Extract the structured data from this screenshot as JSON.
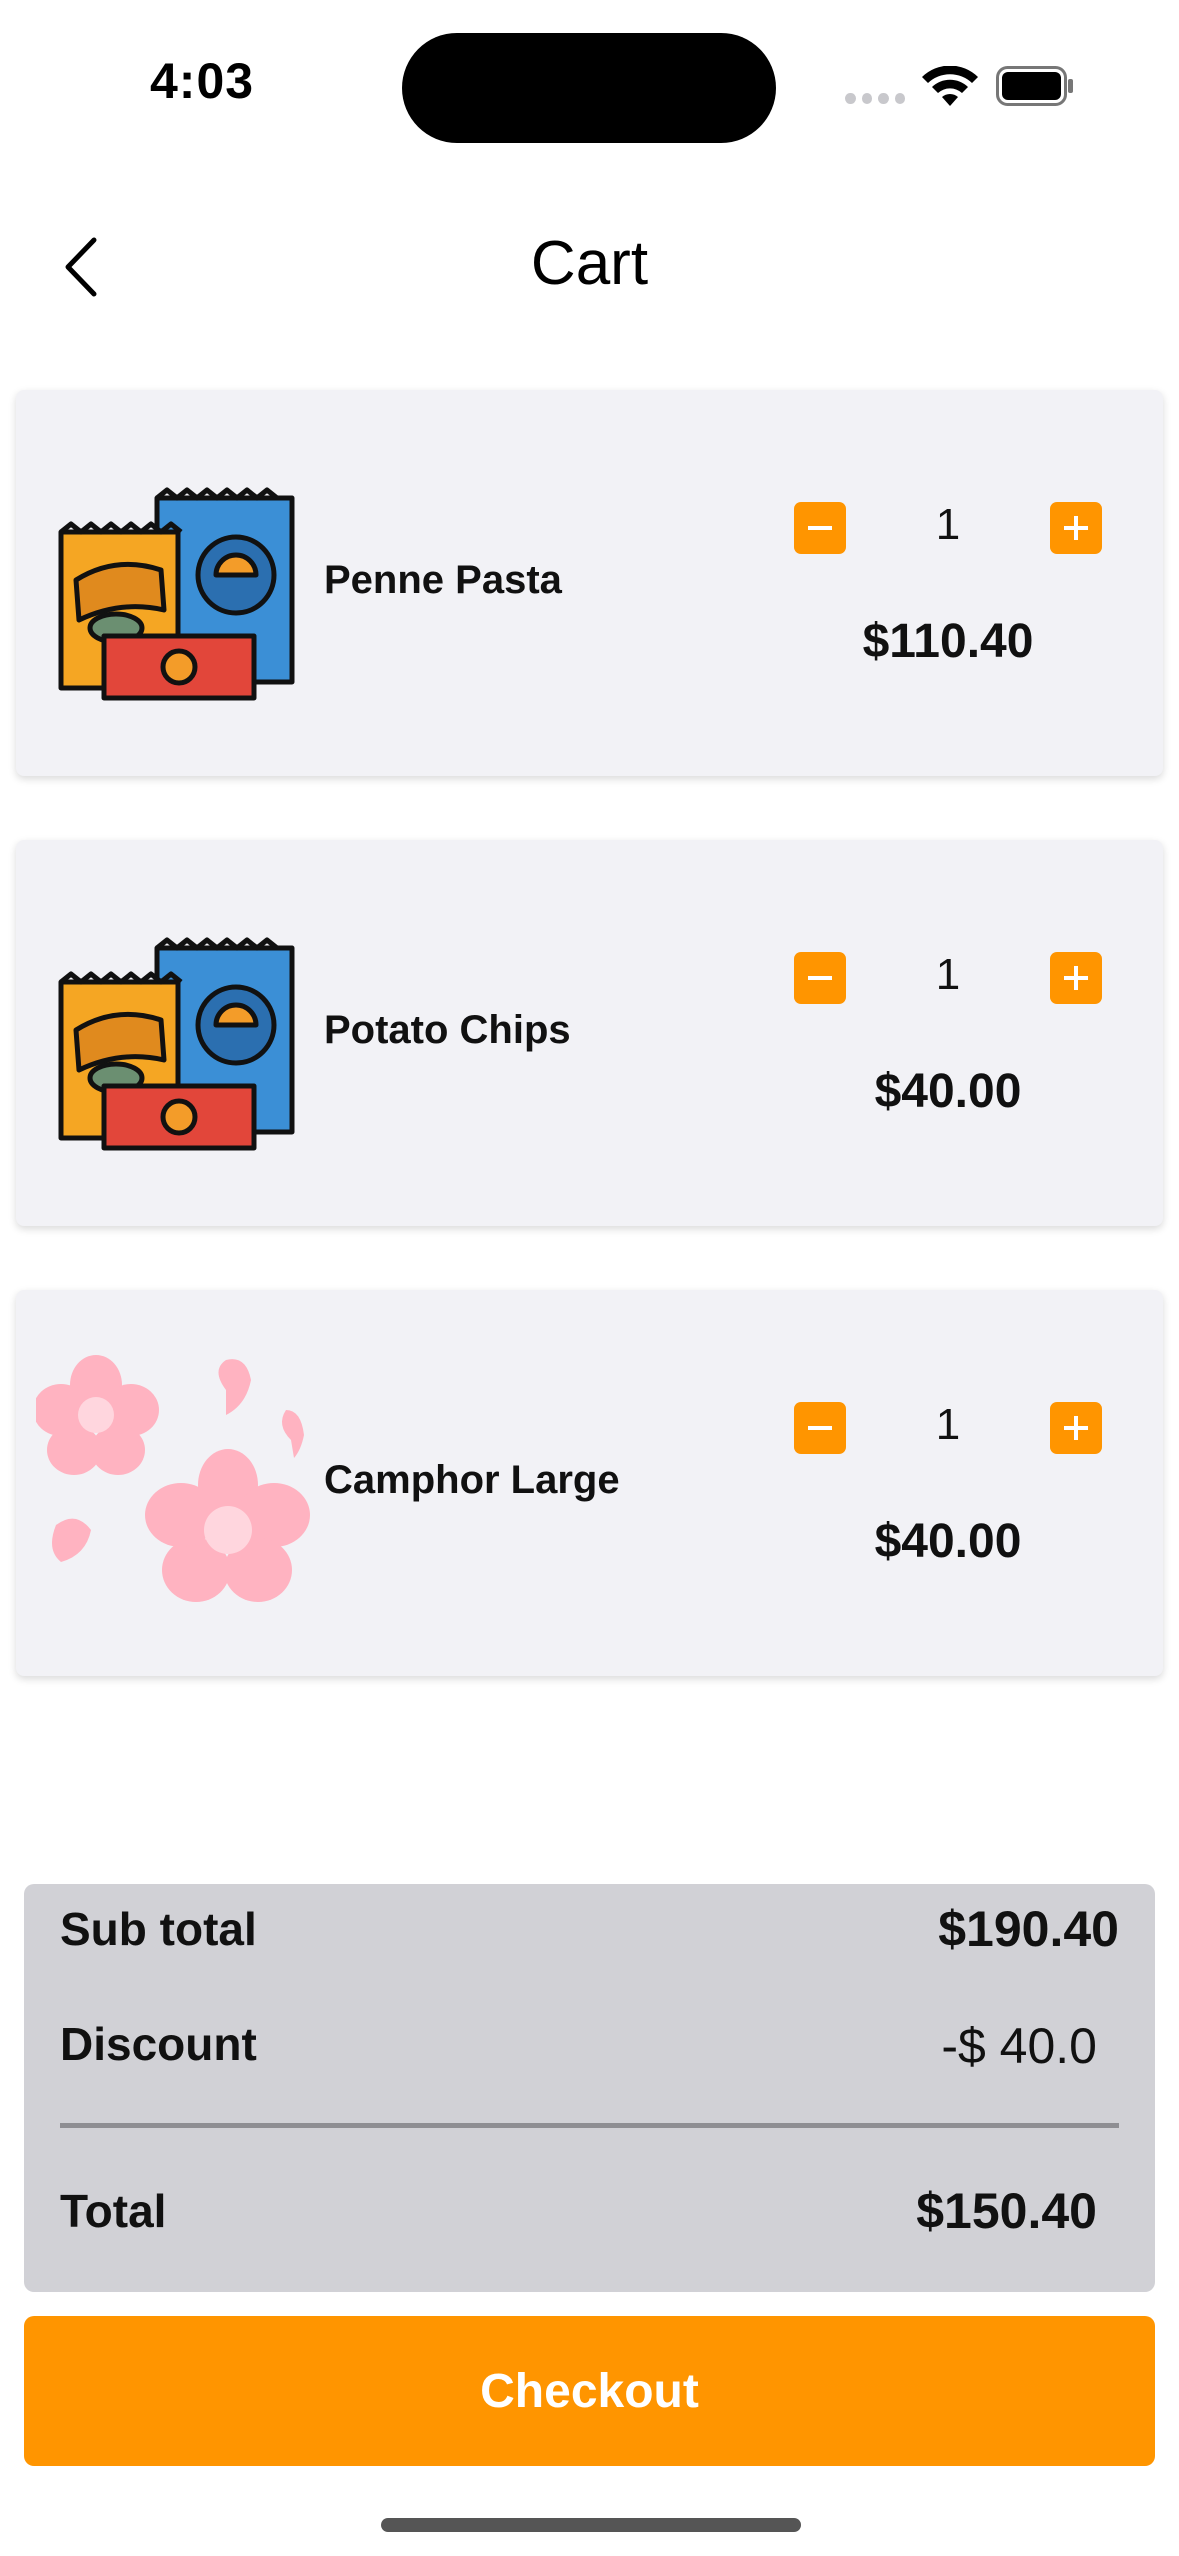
{
  "status_bar": {
    "time": "4:03"
  },
  "header": {
    "title": "Cart"
  },
  "cart": {
    "items": [
      {
        "name": "Penne Pasta",
        "quantity": "1",
        "price": "$110.40",
        "image": "snacks-icon"
      },
      {
        "name": "Potato Chips",
        "quantity": "1",
        "price": "$40.00",
        "image": "snacks-icon"
      },
      {
        "name": "Camphor Large",
        "quantity": "1",
        "price": "$40.00",
        "image": "flowers-icon"
      }
    ]
  },
  "summary": {
    "subtotal_label": "Sub total",
    "subtotal_value": "$190.40",
    "discount_label": "Discount",
    "discount_value": "-$ 40.0",
    "total_label": "Total",
    "total_value": "$150.40"
  },
  "checkout": {
    "label": "Checkout"
  },
  "colors": {
    "accent": "#ff9500",
    "card_bg": "#f2f2f6",
    "summary_bg": "#d1d1d6"
  }
}
